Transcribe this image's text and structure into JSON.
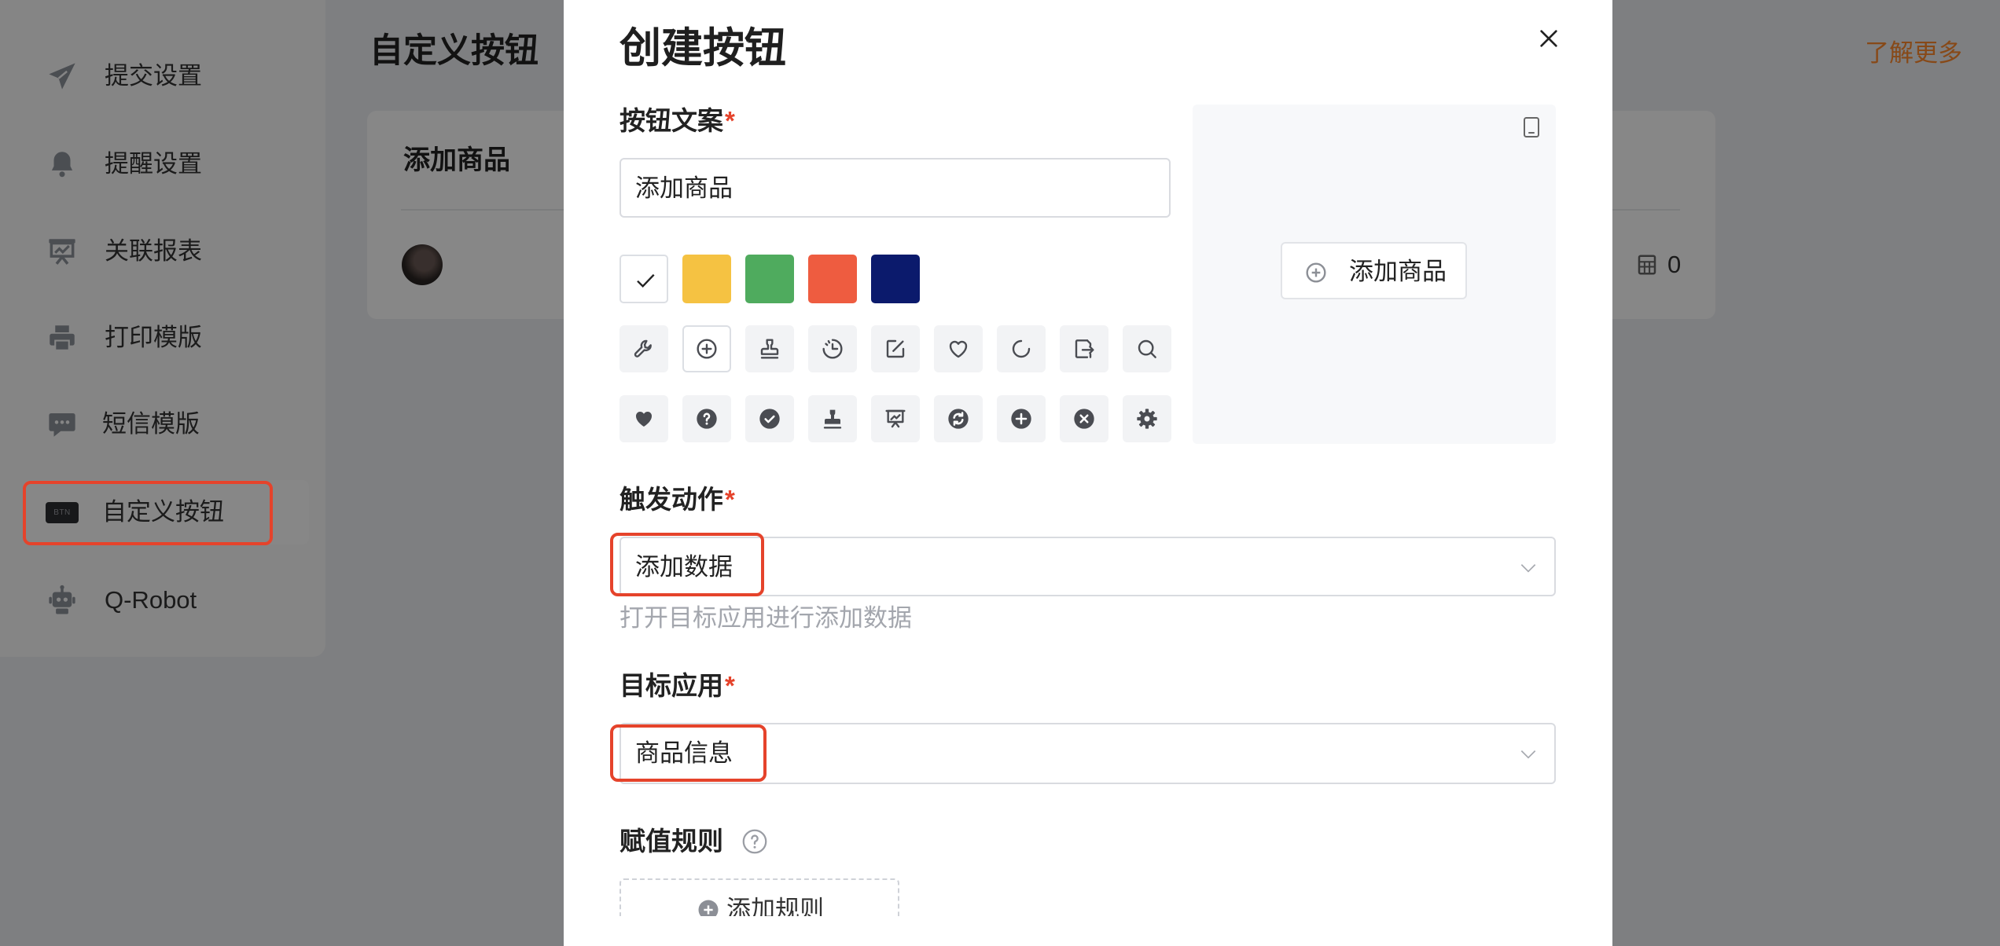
{
  "page": {
    "title": "自定义按钮",
    "learn_more": "了解更多"
  },
  "sidebar": {
    "items": [
      {
        "label": "提交设置",
        "icon": "send-icon"
      },
      {
        "label": "提醒设置",
        "icon": "bell-icon"
      },
      {
        "label": "关联报表",
        "icon": "report-icon"
      },
      {
        "label": "打印模版",
        "icon": "printer-icon"
      },
      {
        "label": "短信模版",
        "icon": "message-icon"
      },
      {
        "label": "自定义按钮",
        "icon": "btn-icon",
        "badge": "BTN",
        "active": true
      },
      {
        "label": "Q-Robot",
        "icon": "robot-icon"
      }
    ]
  },
  "card": {
    "title": "添加商品",
    "count": "0"
  },
  "modal": {
    "title": "创建按钮",
    "button_text": {
      "label": "按钮文案",
      "required": "*",
      "value": "添加商品"
    },
    "colors": [
      "#ffffff",
      "#f5c242",
      "#4fab5e",
      "#ee5c40",
      "#0b1a6c"
    ],
    "selected_color_index": 0,
    "icons": [
      "wrench-icon",
      "plus-circle-icon",
      "stamp-icon",
      "clock-pie-icon",
      "edit-icon",
      "heart-icon",
      "reload-icon",
      "export-icon",
      "search-icon",
      "heart-filled-icon",
      "question-filled-icon",
      "check-filled-icon",
      "stamp-filled-icon",
      "presentation-icon",
      "sync-filled-icon",
      "plus-filled-icon",
      "close-filled-icon",
      "gear-filled-icon"
    ],
    "selected_icon_index": 1,
    "preview": {
      "button_label": "添加商品",
      "button_icon": "plus-circle-icon"
    },
    "trigger": {
      "label": "触发动作",
      "required": "*",
      "value": "添加数据",
      "hint": "打开目标应用进行添加数据"
    },
    "target_app": {
      "label": "目标应用",
      "required": "*",
      "value": "商品信息"
    },
    "assign_rules": {
      "label": "赋值规则",
      "add_label": "添加规则"
    }
  },
  "theme": {
    "required_color": "#e5432b",
    "highlight_color": "#e5432b"
  }
}
